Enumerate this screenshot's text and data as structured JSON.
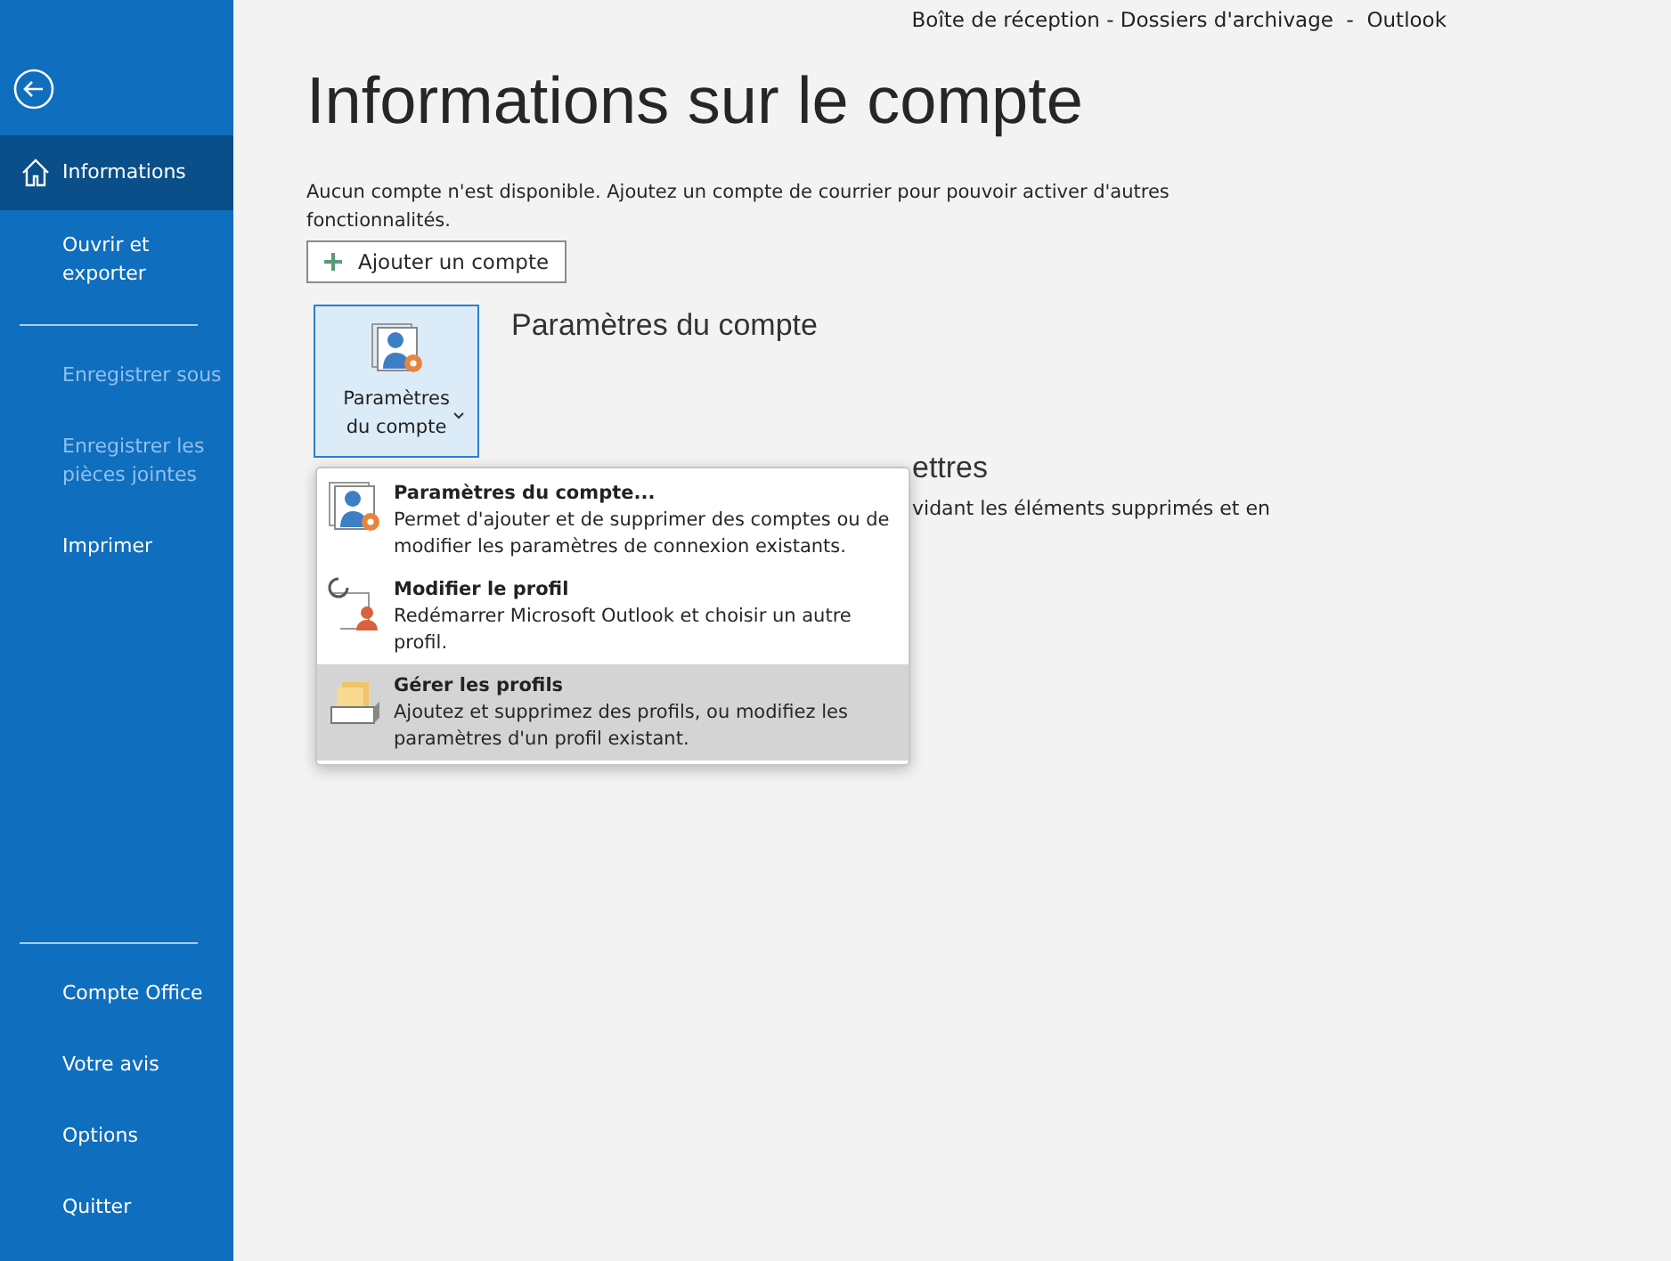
{
  "window": {
    "title": "Boîte de réception - Dossiers d'archivage  -  Outlook"
  },
  "sidebar": {
    "items": [
      {
        "label": "Informations",
        "selected": true,
        "disabled": false,
        "divider_before": false
      },
      {
        "label": "Ouvrir et exporter",
        "selected": false,
        "disabled": false,
        "divider_before": false
      },
      {
        "label": "Enregistrer sous",
        "selected": false,
        "disabled": true,
        "divider_before": true
      },
      {
        "label": "Enregistrer les pièces jointes",
        "selected": false,
        "disabled": true,
        "divider_before": false
      },
      {
        "label": "Imprimer",
        "selected": false,
        "disabled": false,
        "divider_before": false
      }
    ],
    "bottom_items": [
      {
        "label": "Compte Office",
        "selected": false,
        "disabled": false
      },
      {
        "label": "Votre avis",
        "selected": false,
        "disabled": false
      },
      {
        "label": "Options",
        "selected": false,
        "disabled": false
      },
      {
        "label": "Quitter",
        "selected": false,
        "disabled": false
      }
    ]
  },
  "page": {
    "heading": "Informations sur le compte",
    "notice": "Aucun compte n'est disponible. Ajoutez un compte de courrier pour pouvoir activer d'autres fonctionnalités.",
    "add_button": "Ajouter un compte",
    "account_settings": {
      "button": "Paramètres du compte",
      "heading": "Paramètres du compte"
    },
    "hidden_section": {
      "heading": "ettres",
      "text": "vidant les éléments supprimés et en"
    }
  },
  "menu": {
    "items": [
      {
        "kind": "account",
        "title": "Paramètres du compte...",
        "description": "Permet d'ajouter et de supprimer des comptes ou de modifier les paramètres de connexion existants.",
        "selected": false
      },
      {
        "kind": "profile",
        "title": "Modifier le profil",
        "description": "Redémarrer Microsoft Outlook et choisir un autre profil.",
        "selected": false
      },
      {
        "kind": "manage",
        "title": "Gérer les profils",
        "description": "Ajoutez et supprimez des profils, ou modifiez les paramètres d'un profil existant.",
        "selected": true
      }
    ]
  }
}
